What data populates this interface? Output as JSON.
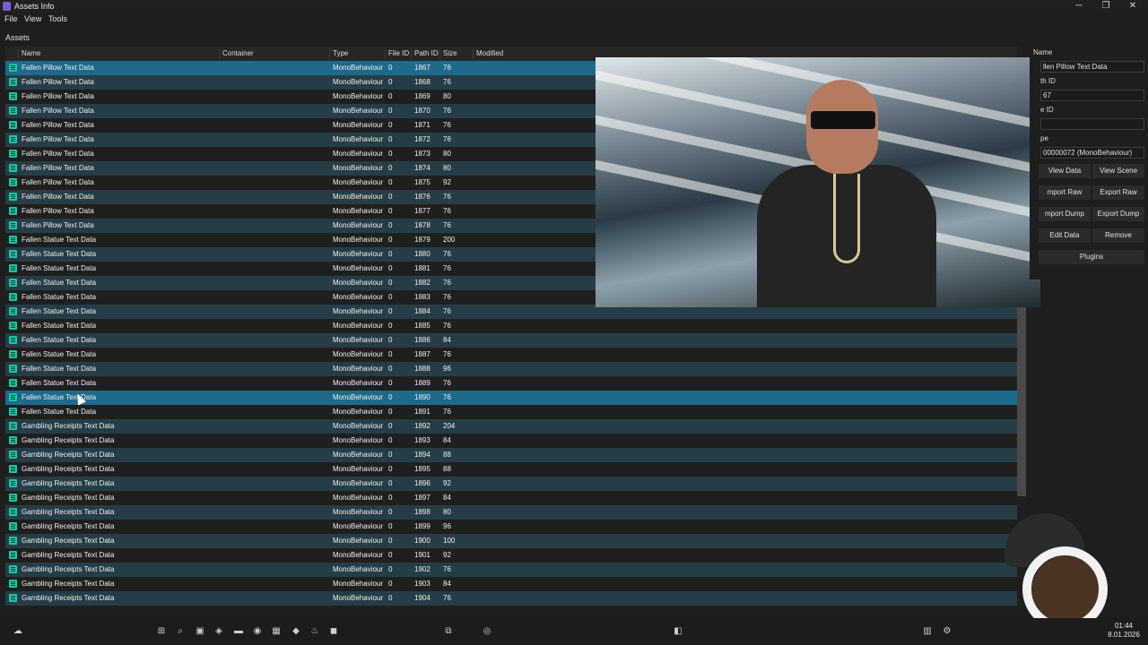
{
  "window": {
    "title": "Assets Info",
    "minimize": "─",
    "maximize": "❐",
    "close": "✕"
  },
  "menu": [
    "File",
    "View",
    "Tools"
  ],
  "assets_label": "Assets",
  "columns": [
    "Name",
    "Container",
    "Type",
    "File ID",
    "Path ID",
    "Size",
    "Modified"
  ],
  "rows": [
    {
      "name": "Fallen Pillow Text Data",
      "type": "MonoBehaviour",
      "file_id": "0",
      "path_id": "1867",
      "size": "76"
    },
    {
      "name": "Fallen Pillow Text Data",
      "type": "MonoBehaviour",
      "file_id": "0",
      "path_id": "1868",
      "size": "76"
    },
    {
      "name": "Fallen Pillow Text Data",
      "type": "MonoBehaviour",
      "file_id": "0",
      "path_id": "1869",
      "size": "80"
    },
    {
      "name": "Fallen Pillow Text Data",
      "type": "MonoBehaviour",
      "file_id": "0",
      "path_id": "1870",
      "size": "76"
    },
    {
      "name": "Fallen Pillow Text Data",
      "type": "MonoBehaviour",
      "file_id": "0",
      "path_id": "1871",
      "size": "76"
    },
    {
      "name": "Fallen Pillow Text Data",
      "type": "MonoBehaviour",
      "file_id": "0",
      "path_id": "1872",
      "size": "76"
    },
    {
      "name": "Fallen Pillow Text Data",
      "type": "MonoBehaviour",
      "file_id": "0",
      "path_id": "1873",
      "size": "80"
    },
    {
      "name": "Fallen Pillow Text Data",
      "type": "MonoBehaviour",
      "file_id": "0",
      "path_id": "1874",
      "size": "80"
    },
    {
      "name": "Fallen Pillow Text Data",
      "type": "MonoBehaviour",
      "file_id": "0",
      "path_id": "1875",
      "size": "92"
    },
    {
      "name": "Fallen Pillow Text Data",
      "type": "MonoBehaviour",
      "file_id": "0",
      "path_id": "1876",
      "size": "76"
    },
    {
      "name": "Fallen Pillow Text Data",
      "type": "MonoBehaviour",
      "file_id": "0",
      "path_id": "1877",
      "size": "76"
    },
    {
      "name": "Fallen Pillow Text Data",
      "type": "MonoBehaviour",
      "file_id": "0",
      "path_id": "1878",
      "size": "76"
    },
    {
      "name": "Fallen Statue Text Data",
      "type": "MonoBehaviour",
      "file_id": "0",
      "path_id": "1879",
      "size": "200"
    },
    {
      "name": "Fallen Statue Text Data",
      "type": "MonoBehaviour",
      "file_id": "0",
      "path_id": "1880",
      "size": "76"
    },
    {
      "name": "Fallen Statue Text Data",
      "type": "MonoBehaviour",
      "file_id": "0",
      "path_id": "1881",
      "size": "76"
    },
    {
      "name": "Fallen Statue Text Data",
      "type": "MonoBehaviour",
      "file_id": "0",
      "path_id": "1882",
      "size": "76"
    },
    {
      "name": "Fallen Statue Text Data",
      "type": "MonoBehaviour",
      "file_id": "0",
      "path_id": "1883",
      "size": "76"
    },
    {
      "name": "Fallen Statue Text Data",
      "type": "MonoBehaviour",
      "file_id": "0",
      "path_id": "1884",
      "size": "76"
    },
    {
      "name": "Fallen Statue Text Data",
      "type": "MonoBehaviour",
      "file_id": "0",
      "path_id": "1885",
      "size": "76"
    },
    {
      "name": "Fallen Statue Text Data",
      "type": "MonoBehaviour",
      "file_id": "0",
      "path_id": "1886",
      "size": "84"
    },
    {
      "name": "Fallen Statue Text Data",
      "type": "MonoBehaviour",
      "file_id": "0",
      "path_id": "1887",
      "size": "76"
    },
    {
      "name": "Fallen Statue Text Data",
      "type": "MonoBehaviour",
      "file_id": "0",
      "path_id": "1888",
      "size": "96"
    },
    {
      "name": "Fallen Statue Text Data",
      "type": "MonoBehaviour",
      "file_id": "0",
      "path_id": "1889",
      "size": "76"
    },
    {
      "name": "Fallen Statue Text Data",
      "type": "MonoBehaviour",
      "file_id": "0",
      "path_id": "1890",
      "size": "76"
    },
    {
      "name": "Fallen Statue Text Data",
      "type": "MonoBehaviour",
      "file_id": "0",
      "path_id": "1891",
      "size": "76"
    },
    {
      "name": "Gambling Receipts Text Data",
      "type": "MonoBehaviour",
      "file_id": "0",
      "path_id": "1892",
      "size": "204"
    },
    {
      "name": "Gambling Receipts Text Data",
      "type": "MonoBehaviour",
      "file_id": "0",
      "path_id": "1893",
      "size": "84"
    },
    {
      "name": "Gambling Receipts Text Data",
      "type": "MonoBehaviour",
      "file_id": "0",
      "path_id": "1894",
      "size": "88"
    },
    {
      "name": "Gambling Receipts Text Data",
      "type": "MonoBehaviour",
      "file_id": "0",
      "path_id": "1895",
      "size": "88"
    },
    {
      "name": "Gambling Receipts Text Data",
      "type": "MonoBehaviour",
      "file_id": "0",
      "path_id": "1896",
      "size": "92"
    },
    {
      "name": "Gambling Receipts Text Data",
      "type": "MonoBehaviour",
      "file_id": "0",
      "path_id": "1897",
      "size": "84"
    },
    {
      "name": "Gambling Receipts Text Data",
      "type": "MonoBehaviour",
      "file_id": "0",
      "path_id": "1898",
      "size": "80"
    },
    {
      "name": "Gambling Receipts Text Data",
      "type": "MonoBehaviour",
      "file_id": "0",
      "path_id": "1899",
      "size": "96"
    },
    {
      "name": "Gambling Receipts Text Data",
      "type": "MonoBehaviour",
      "file_id": "0",
      "path_id": "1900",
      "size": "100"
    },
    {
      "name": "Gambling Receipts Text Data",
      "type": "MonoBehaviour",
      "file_id": "0",
      "path_id": "1901",
      "size": "92"
    },
    {
      "name": "Gambling Receipts Text Data",
      "type": "MonoBehaviour",
      "file_id": "0",
      "path_id": "1902",
      "size": "76"
    },
    {
      "name": "Gambling Receipts Text Data",
      "type": "MonoBehaviour",
      "file_id": "0",
      "path_id": "1903",
      "size": "84"
    },
    {
      "name": "Gambling Receipts Text Data",
      "type": "MonoBehaviour",
      "file_id": "0",
      "path_id": "1904",
      "size": "76"
    }
  ],
  "selected_row_index": 0,
  "hover_row_index": 23,
  "panel": {
    "name_label": "Name",
    "name_value": "llen Pillow Text Data",
    "path_label": "th ID",
    "path_value": "67",
    "file_label": "e ID",
    "file_value": "",
    "type_label": "pe",
    "type_value": "00000072 (MonoBehaviour)",
    "buttons": [
      "View Data",
      "View Scene",
      "mport Raw",
      "Export Raw",
      "mport Dump",
      "Export Dump",
      "Edit Data",
      "Remove",
      "Plugins"
    ]
  },
  "taskbar": {
    "time": "01:44",
    "date": "8.01.2026"
  },
  "colors": {
    "selected": "#1e6a8a",
    "alt_row": "#263d47",
    "icon": "#1cc7a6"
  }
}
